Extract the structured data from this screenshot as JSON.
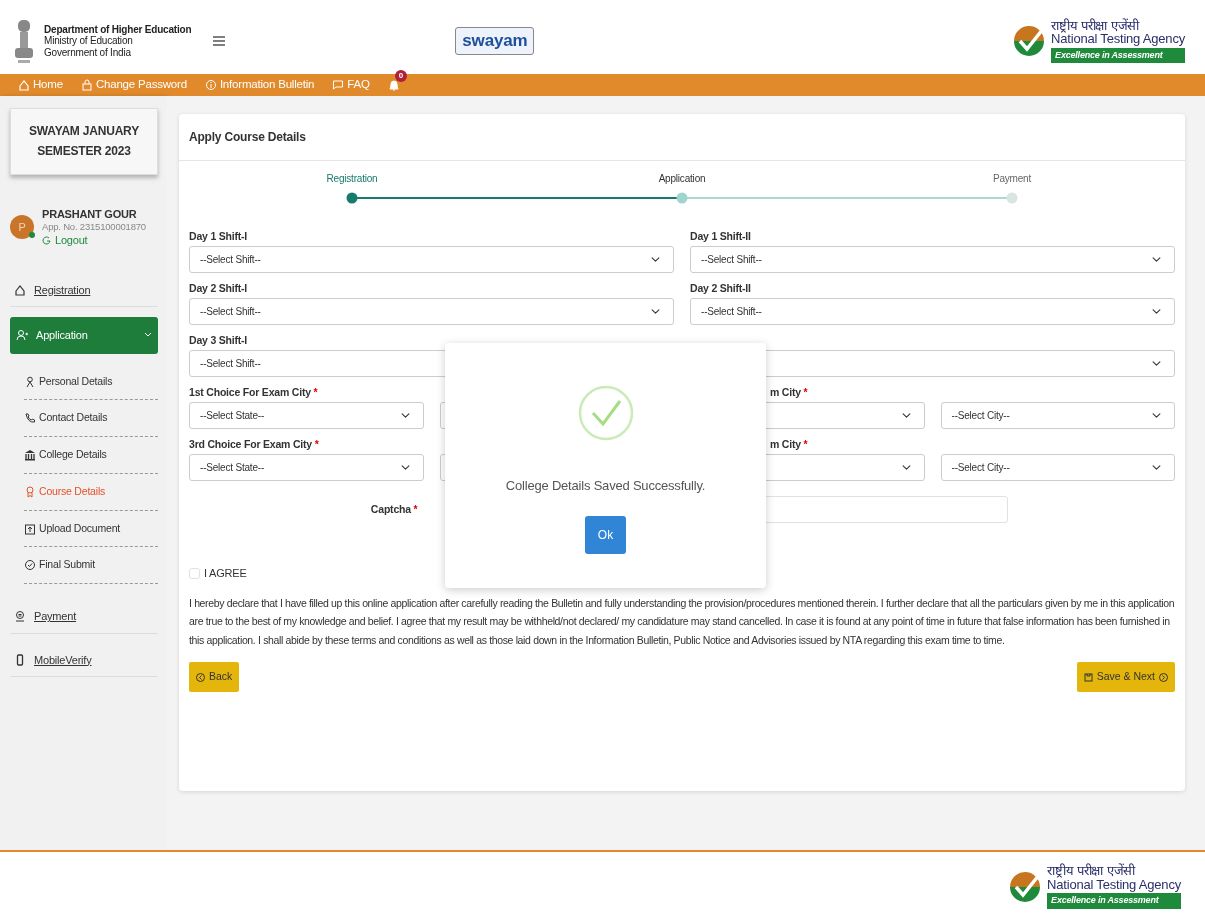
{
  "header": {
    "department": [
      "Department of Higher Education",
      "Ministry of Education",
      "Government of India"
    ],
    "center_logo": "swayam",
    "agency": {
      "hindi": "राष्ट्रीय परीक्षा एजेंसी",
      "english": "National Testing Agency",
      "tagline": "Excellence in Assessment"
    }
  },
  "nav": {
    "items": [
      {
        "label": "Home",
        "kind": "home"
      },
      {
        "label": "Change Password",
        "kind": "lock"
      },
      {
        "label": "Information Bulletin",
        "kind": "info"
      },
      {
        "label": "FAQ",
        "kind": "chat"
      }
    ],
    "notification_count": "0"
  },
  "sidebar": {
    "exam_title": "SWAYAM JANUARY SEMESTER 2023",
    "user": {
      "initial": "P",
      "name": "PRASHANT GOUR",
      "app_no": "App. No. 2315100001870",
      "logout": "Logout"
    },
    "menu": [
      {
        "label": "Registration",
        "kind": "home",
        "selected": false
      },
      {
        "label": "Application",
        "kind": "user",
        "selected": true,
        "expanded": true,
        "children": [
          {
            "label": "Personal Details",
            "kind": "person",
            "selected": false
          },
          {
            "label": "Contact Details",
            "kind": "phone",
            "selected": false
          },
          {
            "label": "College Details",
            "kind": "bank",
            "selected": false
          },
          {
            "label": "Course Details",
            "kind": "award",
            "selected": true
          },
          {
            "label": "Upload Document",
            "kind": "upload",
            "selected": false
          },
          {
            "label": "Final Submit",
            "kind": "check",
            "selected": false
          }
        ]
      },
      {
        "label": "Payment",
        "kind": "pay",
        "selected": false
      },
      {
        "label": "MobileVerify",
        "kind": "mobile",
        "selected": false
      }
    ]
  },
  "card": {
    "title": "Apply Course Details",
    "steps": [
      {
        "label": "Registration",
        "completed": true,
        "selected": false
      },
      {
        "label": "Application",
        "completed": false,
        "selected": true
      },
      {
        "label": "Payment",
        "completed": false,
        "selected": false
      }
    ],
    "shift_fields": [
      {
        "label": "Day 1 Shift-I",
        "value": "--Select Shift--"
      },
      {
        "label": "Day 1 Shift-II",
        "value": "--Select Shift--"
      },
      {
        "label": "Day 2 Shift-I",
        "value": "--Select Shift--"
      },
      {
        "label": "Day 2 Shift-II",
        "value": "--Select Shift--"
      },
      {
        "label": "Day 3 Shift-I",
        "value": "--Select Shift--"
      }
    ],
    "city_fields": [
      {
        "kind": "full",
        "label": "1st Choice For Exam City",
        "required_mark": "*",
        "state_value": "--Select State--"
      },
      {
        "kind": "cut",
        "label": "m City",
        "required_mark": "*",
        "city_value": "--Select City--"
      },
      {
        "kind": "full",
        "label": "3rd Choice For Exam City",
        "required_mark": "*",
        "state_value": "--Select State--"
      },
      {
        "kind": "cut",
        "label": "m City",
        "required_mark": "*",
        "city_value": "--Select City--"
      }
    ],
    "captcha": {
      "label": "Captcha",
      "required_mark": "*"
    },
    "agree": {
      "label": "I AGREE",
      "checked": false
    },
    "declaration": "I hereby declare that I have filled up this online application after carefully reading the Bulletin and fully understanding the provision/procedures mentioned therein. I further declare that all the particulars given by me in this application are true to the best of my knowledge and belief. I agree that my result may be withheld/not declared/ my candidature may stand cancelled. In case it is found at any point of time in future that false information has been furnished in this application. I shall abide by these terms and conditions as well as those laid down in the Information Bulletin, Public Notice and Advisories issued by NTA regarding this exam time to time.",
    "back_button": "Back",
    "next_button": "Save & Next"
  },
  "modal": {
    "message": "College Details Saved Successfully.",
    "button": "Ok"
  },
  "footer": {
    "agency": {
      "hindi": "राष्ट्रीय परीक्षा एजेंसी",
      "english": "National Testing Agency",
      "tagline": "Excellence in Assessment"
    }
  }
}
